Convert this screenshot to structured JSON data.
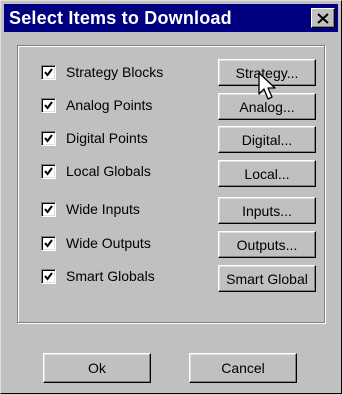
{
  "window": {
    "title": "Select Items to Download",
    "close_glyph": "×",
    "close_icon": "close-icon"
  },
  "items": [
    {
      "label": "Strategy Blocks",
      "checked": true,
      "button": "Strategy..."
    },
    {
      "label": "Analog Points",
      "checked": true,
      "button": "Analog..."
    },
    {
      "label": "Digital Points",
      "checked": true,
      "button": "Digital..."
    },
    {
      "label": "Local Globals",
      "checked": true,
      "button": "Local..."
    },
    {
      "label": "Wide Inputs",
      "checked": true,
      "button": "Inputs..."
    },
    {
      "label": "Wide Outputs",
      "checked": true,
      "button": "Outputs..."
    },
    {
      "label": "Smart Globals",
      "checked": true,
      "button": "Smart Global"
    }
  ],
  "footer": {
    "ok_label": "Ok",
    "cancel_label": "Cancel"
  },
  "colors": {
    "titlebar": "#000080",
    "face": "#c0c0c0",
    "title_text": "#ffffff"
  },
  "icons": {
    "checkbox_mark": "checkmark-icon",
    "pointer": "arrow-cursor-icon"
  }
}
